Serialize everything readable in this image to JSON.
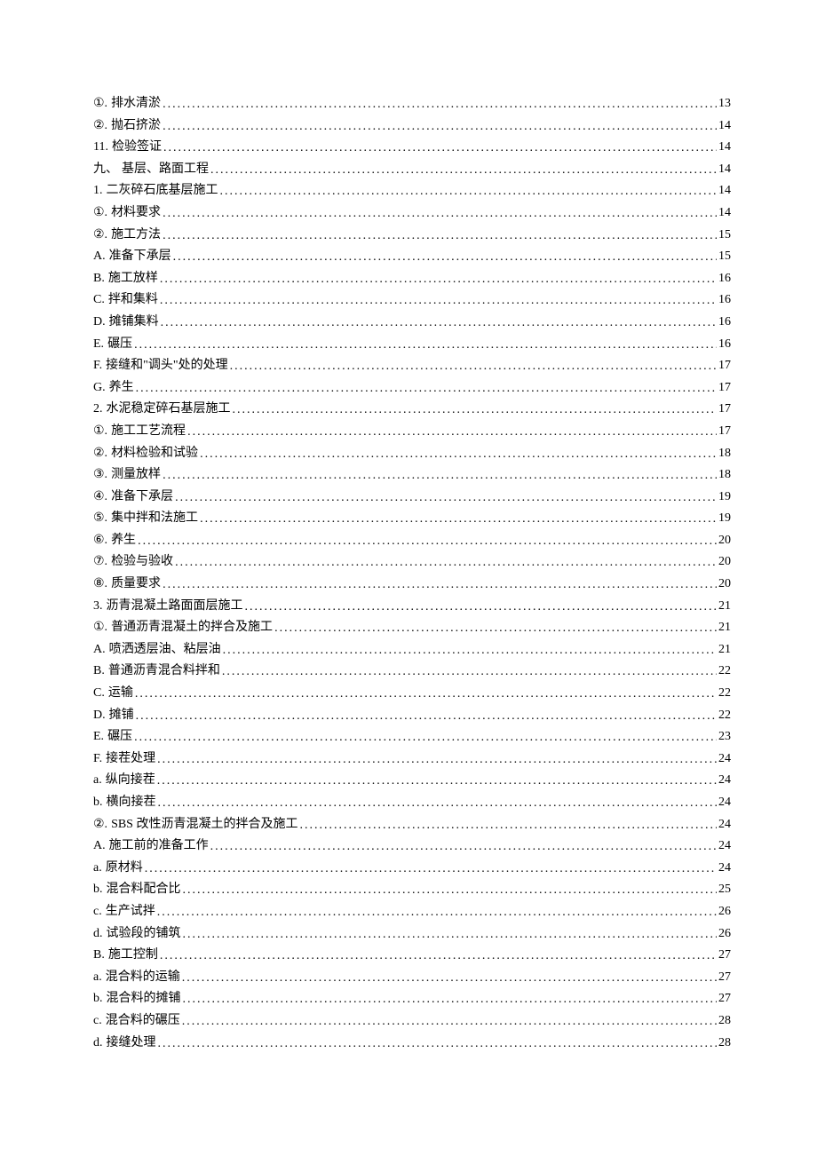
{
  "entries": [
    {
      "id": "i-1",
      "marker": "①.",
      "title": "排水清淤",
      "page": "13"
    },
    {
      "id": "i-2",
      "marker": "②.",
      "title": "抛石挤淤",
      "page": "14"
    },
    {
      "id": "i-3",
      "marker": "11.",
      "title": " 检验签证",
      "page": "14"
    },
    {
      "id": "i-4",
      "marker": "九、",
      "title": " 基层、路面工程",
      "page": "14"
    },
    {
      "id": "i-5",
      "marker": "1.",
      "title": "  二灰碎石底基层施工",
      "page": "14"
    },
    {
      "id": "i-6",
      "marker": "①.",
      "title": "材料要求",
      "page": "14"
    },
    {
      "id": "i-7",
      "marker": "②.",
      "title": "施工方法",
      "page": "15"
    },
    {
      "id": "i-8",
      "marker": "A.",
      "title": "准备下承层",
      "page": "15"
    },
    {
      "id": "i-9",
      "marker": "B.",
      "title": "施工放样",
      "page": "16"
    },
    {
      "id": "i-10",
      "marker": "C.",
      "title": "拌和集料",
      "page": "16"
    },
    {
      "id": "i-11",
      "marker": "D.",
      "title": "摊铺集料",
      "page": "16"
    },
    {
      "id": "i-12",
      "marker": "E.",
      "title": "碾压",
      "page": "16"
    },
    {
      "id": "i-13",
      "marker": "F.",
      "title": "接缝和\"调头\"处的处理",
      "page": "17"
    },
    {
      "id": "i-14",
      "marker": "G.",
      "title": "养生",
      "page": "17"
    },
    {
      "id": "i-15",
      "marker": "2.",
      "title": "  水泥稳定碎石基层施工",
      "page": "17"
    },
    {
      "id": "i-16",
      "marker": "①.",
      "title": "施工工艺流程",
      "page": "17"
    },
    {
      "id": "i-17",
      "marker": "②.",
      "title": "材料检验和试验",
      "page": "18"
    },
    {
      "id": "i-18",
      "marker": "③.",
      "title": "测量放样",
      "page": "18"
    },
    {
      "id": "i-19",
      "marker": "④.",
      "title": "准备下承层",
      "page": "19"
    },
    {
      "id": "i-20",
      "marker": "⑤.",
      "title": "集中拌和法施工",
      "page": "19"
    },
    {
      "id": "i-21",
      "marker": "⑥.",
      "title": "养生",
      "page": "20"
    },
    {
      "id": "i-22",
      "marker": "⑦.",
      "title": "检验与验收",
      "page": "20"
    },
    {
      "id": "i-23",
      "marker": "⑧.",
      "title": "质量要求",
      "page": "20"
    },
    {
      "id": "i-24",
      "marker": "3.",
      "title": "  沥青混凝土路面面层施工",
      "page": "21"
    },
    {
      "id": "i-25",
      "marker": "①.",
      "title": " 普通沥青混凝土的拌合及施工",
      "page": "21"
    },
    {
      "id": "i-26",
      "marker": "A.",
      "title": "喷洒透层油、粘层油",
      "page": "21"
    },
    {
      "id": "i-27",
      "marker": "B.",
      "title": "普通沥青混合料拌和",
      "page": "22"
    },
    {
      "id": "i-28",
      "marker": "C.",
      "title": "运输",
      "page": "22"
    },
    {
      "id": "i-29",
      "marker": "D.",
      "title": "摊铺",
      "page": "22"
    },
    {
      "id": "i-30",
      "marker": "E.",
      "title": "碾压",
      "page": "23"
    },
    {
      "id": "i-31",
      "marker": "F.",
      "title": "接茬处理",
      "page": "24"
    },
    {
      "id": "i-32",
      "marker": "a.",
      "title": "纵向接茬",
      "page": "24"
    },
    {
      "id": "i-33",
      "marker": "b.",
      "title": "横向接茬",
      "page": "24"
    },
    {
      "id": "i-34",
      "marker": "②.",
      "title": "SBS 改性沥青混凝土的拌合及施工 ",
      "page": "24"
    },
    {
      "id": "i-35",
      "marker": "A.",
      "title": "施工前的准备工作",
      "page": "24"
    },
    {
      "id": "i-36",
      "marker": "a.",
      "title": "原材料",
      "page": "24"
    },
    {
      "id": "i-37",
      "marker": "b.",
      "title": "混合料配合比",
      "page": "25"
    },
    {
      "id": "i-38",
      "marker": "c.",
      "title": "生产试拌",
      "page": "26"
    },
    {
      "id": "i-39",
      "marker": "d.",
      "title": "试验段的铺筑",
      "page": "26"
    },
    {
      "id": "i-40",
      "marker": "B.",
      "title": "施工控制",
      "page": "27"
    },
    {
      "id": "i-41",
      "marker": "a.",
      "title": "混合料的运输",
      "page": "27"
    },
    {
      "id": "i-42",
      "marker": "b.",
      "title": "混合料的摊铺",
      "page": "27"
    },
    {
      "id": "i-43",
      "marker": "c.",
      "title": "混合料的碾压",
      "page": "28"
    },
    {
      "id": "i-44",
      "marker": "d.",
      "title": "接缝处理",
      "page": "28"
    }
  ]
}
